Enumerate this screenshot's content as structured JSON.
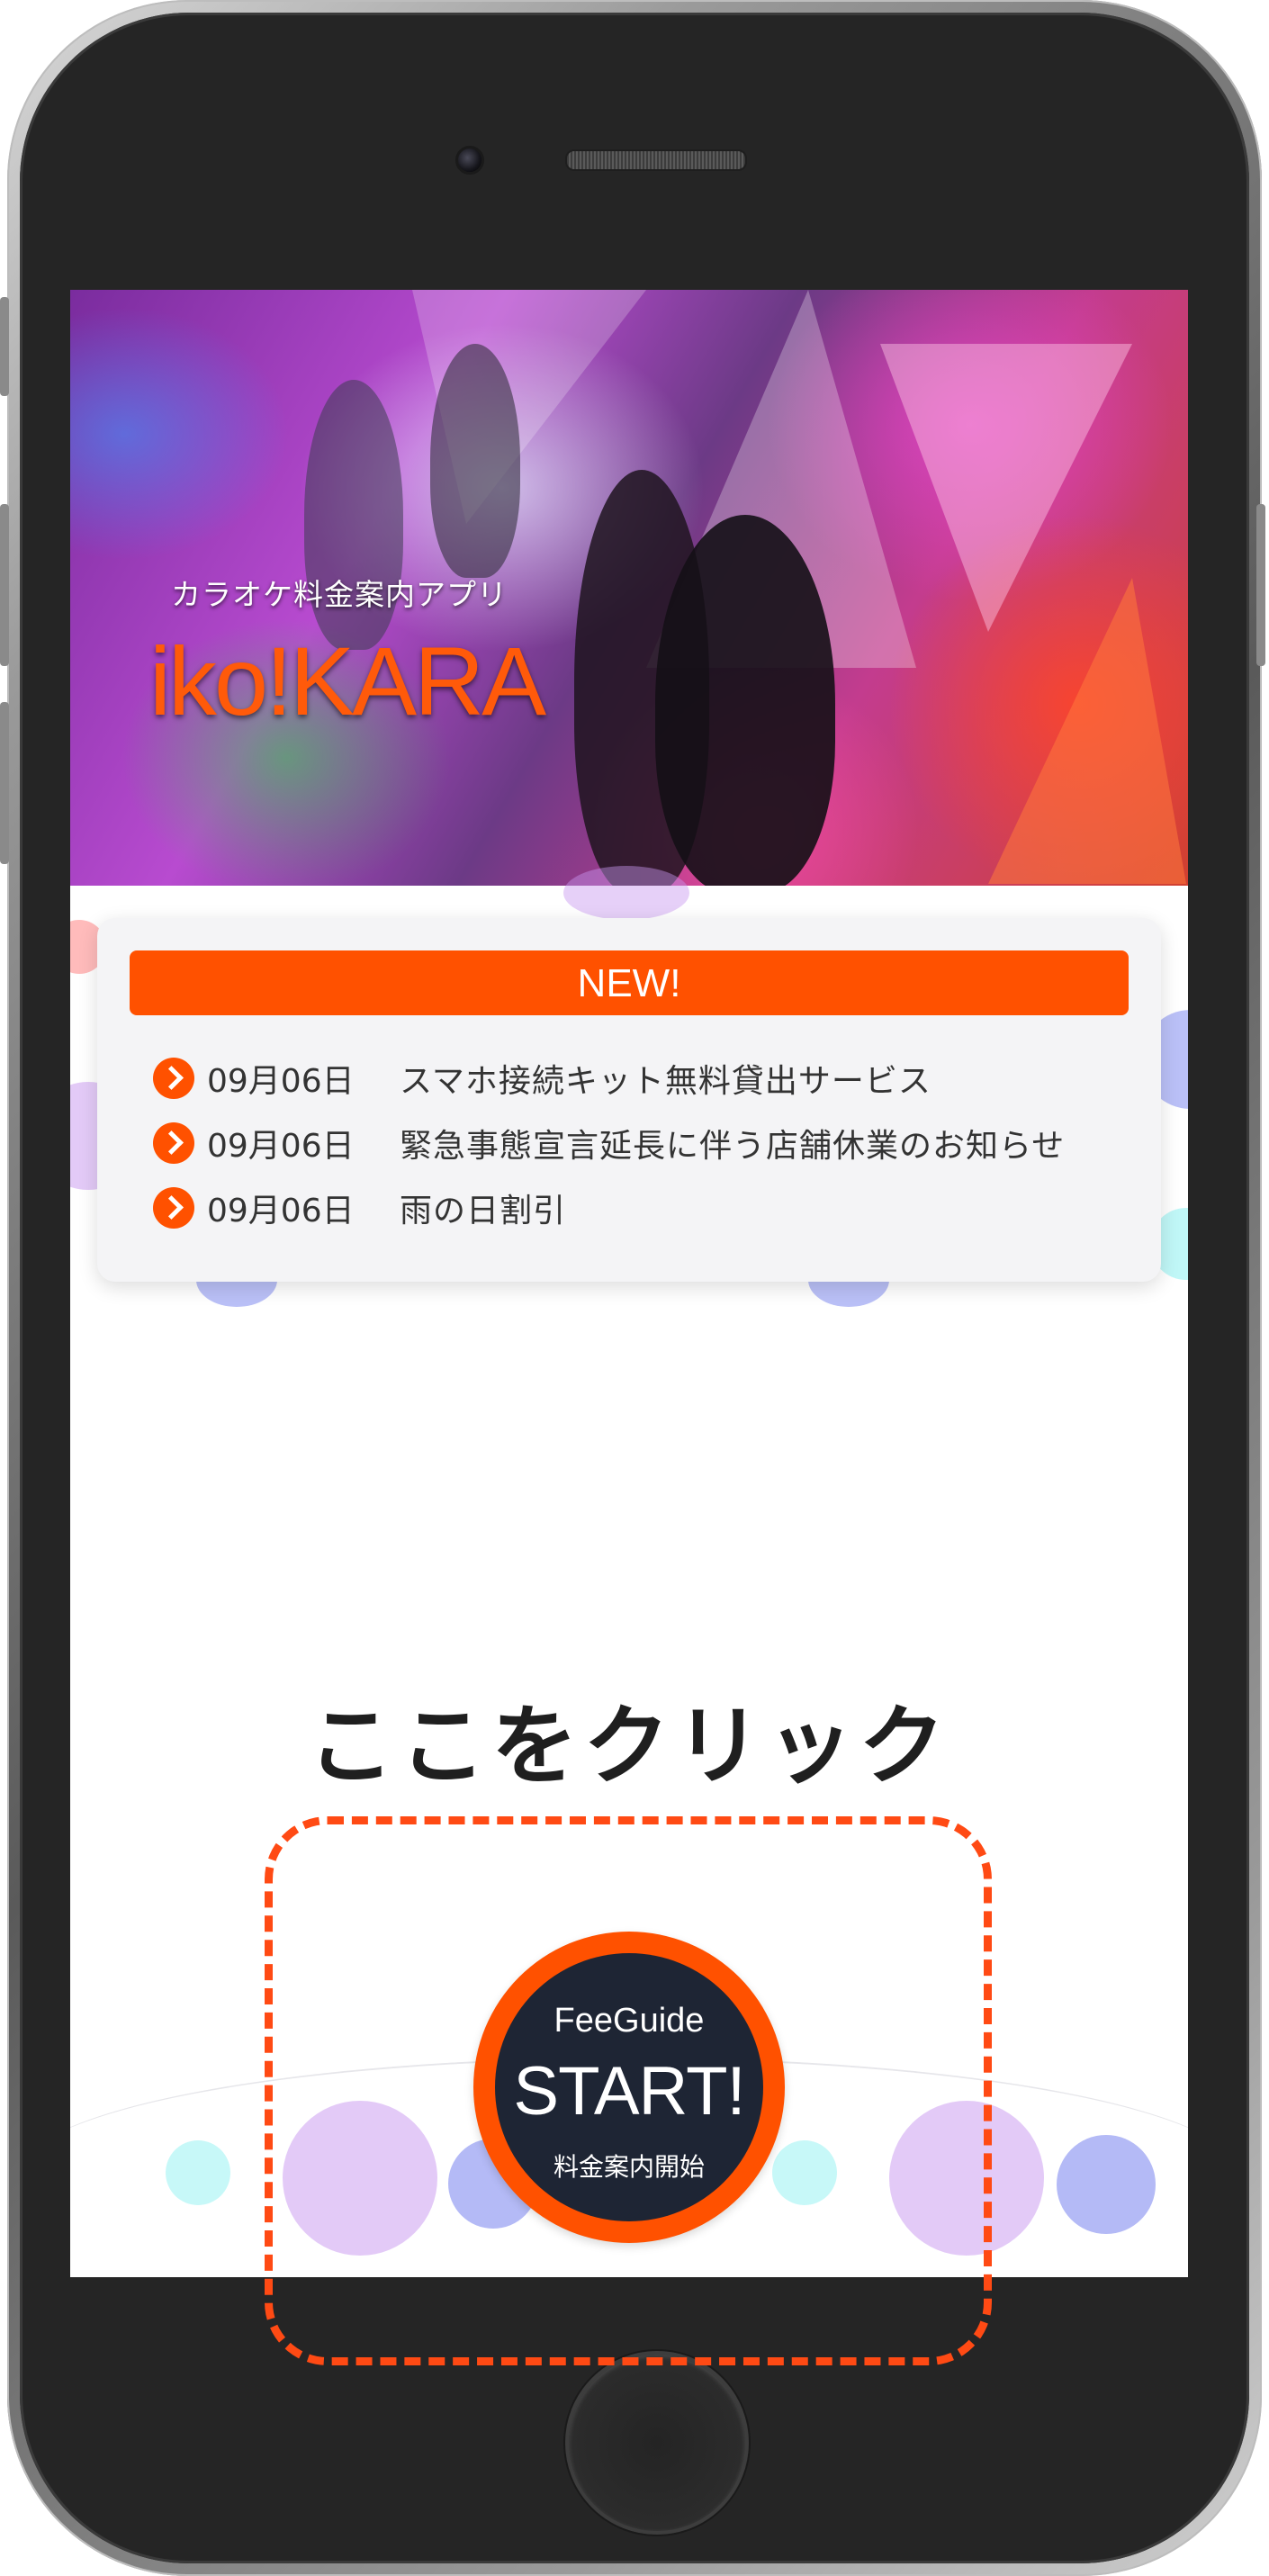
{
  "app": {
    "subtitle": "カラオケ料金案内アプリ",
    "title": "iko!KARA"
  },
  "news": {
    "header": "NEW!",
    "items": [
      {
        "date": "09月06日",
        "text": "スマホ接続キット無料貸出サービス"
      },
      {
        "date": "09月06日",
        "text": "緊急事態宣言延長に伴う店舗休業のお知らせ"
      },
      {
        "date": "09月06日",
        "text": "雨の日割引"
      }
    ]
  },
  "cta": {
    "label": "ここをクリック"
  },
  "start_button": {
    "top_text": "FeeGuide",
    "main_text": "START!",
    "bottom_text": "料金案内開始"
  },
  "colors": {
    "accent": "#ff5100",
    "button_inner": "#1e2534",
    "dashed_outline": "#ff4a14"
  },
  "icons": {
    "news_bullet": "chevron-right-circle-icon"
  }
}
